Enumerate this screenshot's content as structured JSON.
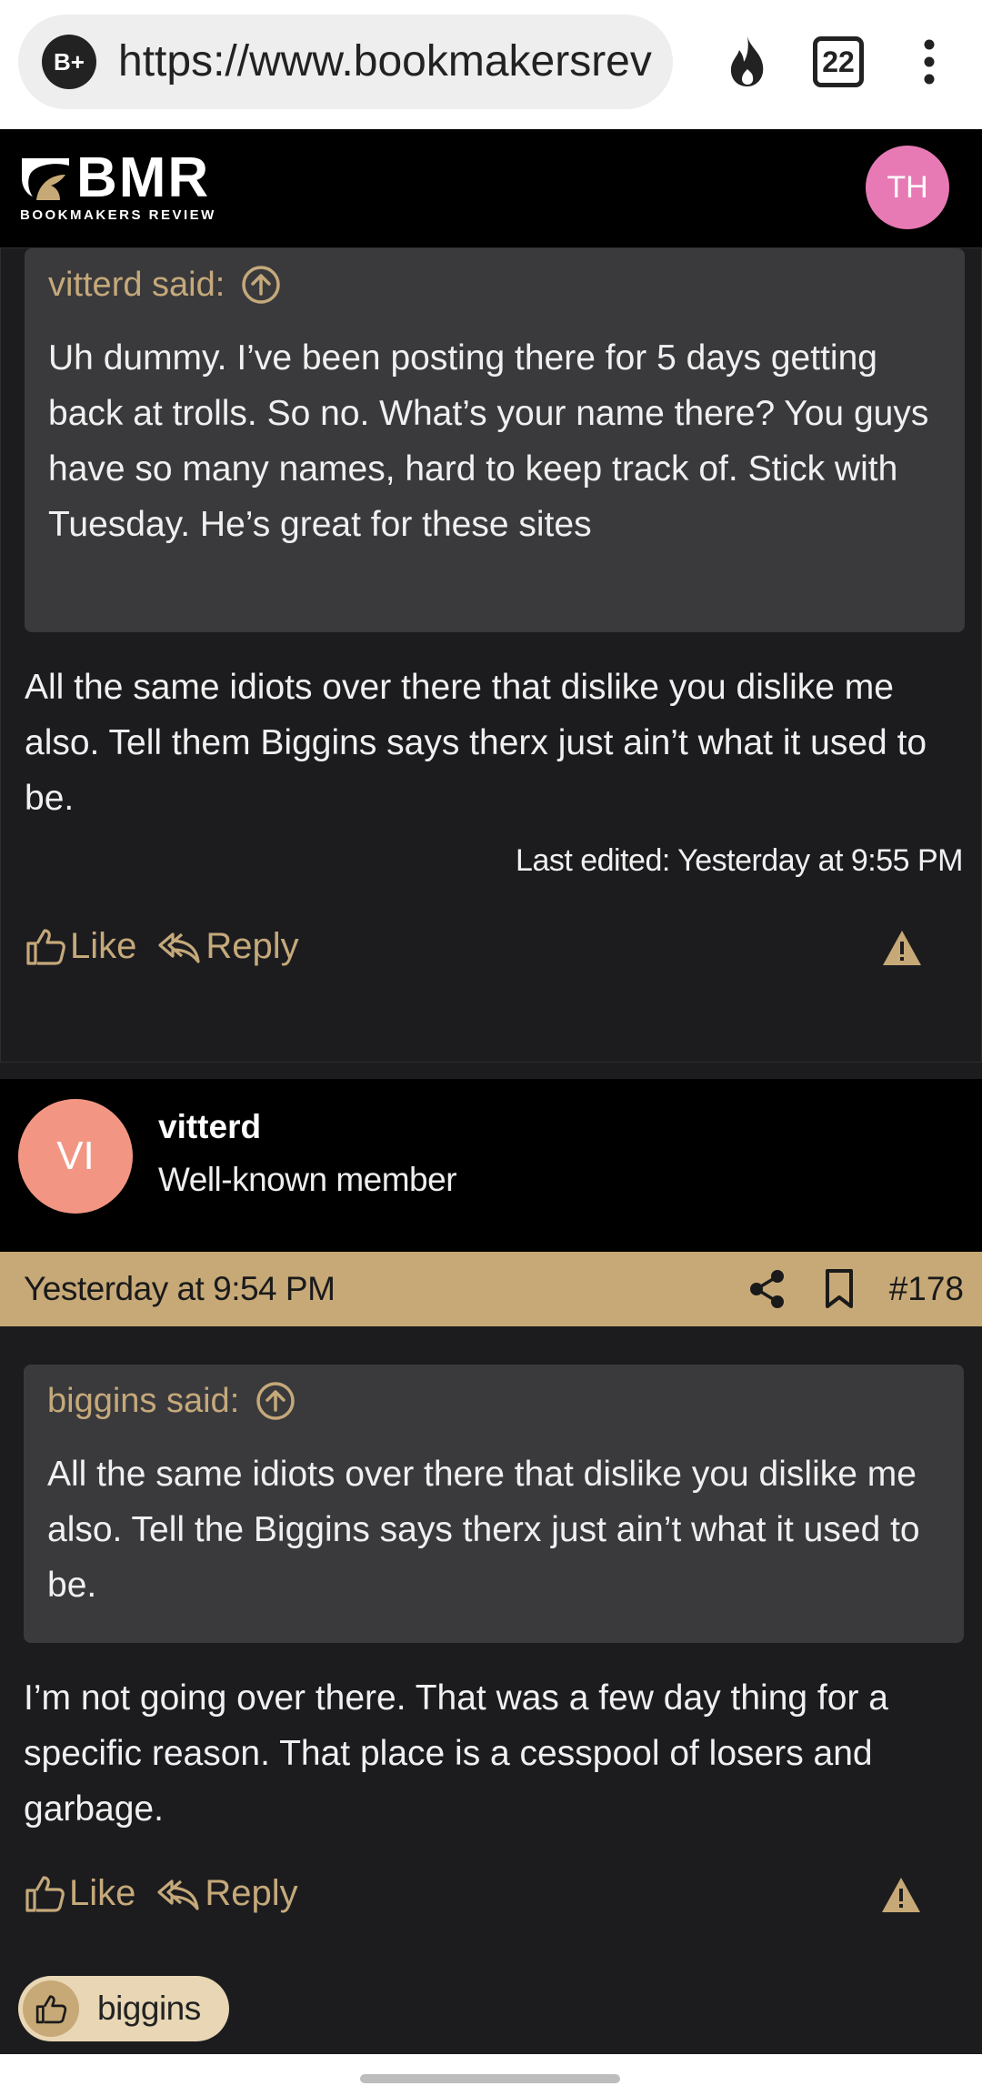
{
  "browser": {
    "url": "https://www.bookmakersrev",
    "site_badge": "B+",
    "tab_count": "22"
  },
  "site": {
    "logo_main": "BMR",
    "logo_sub": "BOOKMAKERS REVIEW",
    "user_initials": "TH"
  },
  "post1": {
    "quote_author": "vitterd said:",
    "quote_text": "Uh dummy. I’ve been posting there for 5 days getting back at trolls. So no. What’s your name there? You guys have so many names, hard to keep track of. Stick with Tuesday. He’s great for these sites",
    "body": "All the same idiots over there that dislike you dislike me also. Tell them Biggins says therx just ain’t what it used to be.",
    "edited": "Last edited: Yesterday at 9:55 PM",
    "like_label": "Like",
    "reply_label": "Reply"
  },
  "post2": {
    "member_initials": "VI",
    "member_name": "vitterd",
    "member_role": "Well-known member",
    "date": "Yesterday at 9:54 PM",
    "post_number": "#178",
    "quote_author": "biggins said:",
    "quote_text": "All the same idiots over there that dislike you dislike me also. Tell the Biggins says therx just ain’t what it used to be.",
    "body": "I’m not going over there. That was a few day thing for a specific reason. That place is a cesspool of losers and garbage.",
    "like_label": "Like",
    "reply_label": "Reply",
    "reaction_user": "biggins"
  },
  "colors": {
    "accent": "#c7a977",
    "quote_bg": "#3a3a3d",
    "page_bg": "#1c1c1f",
    "avatar_th": "#e77ab4",
    "avatar_vi": "#f29683"
  }
}
